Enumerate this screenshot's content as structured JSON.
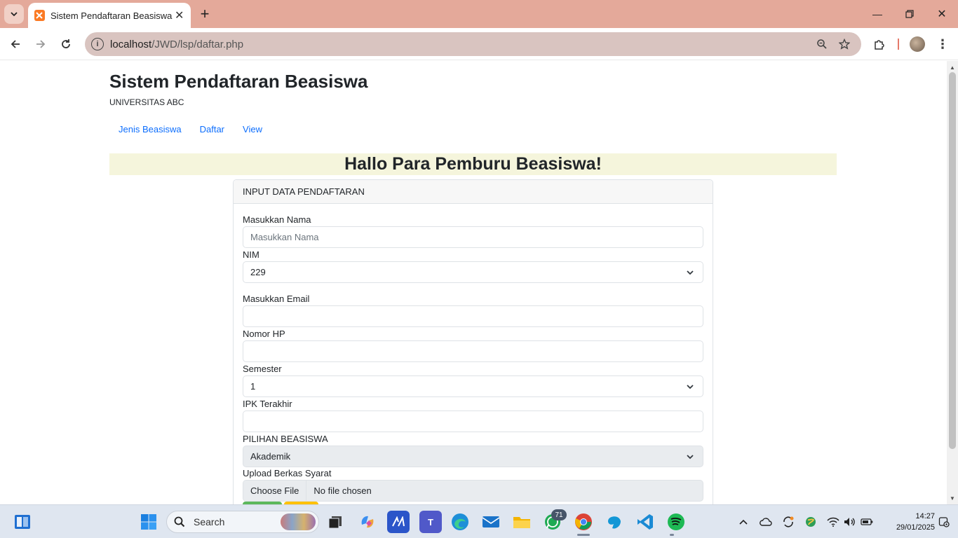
{
  "browser": {
    "tab_title": "Sistem Pendaftaran Beasiswa",
    "url_host": "localhost",
    "url_path": "/JWD/lsp/daftar.php"
  },
  "page": {
    "site_title": "Sistem Pendaftaran Beasiswa",
    "site_subtitle": "UNIVERSITAS ABC",
    "nav": [
      "Jenis Beasiswa",
      "Daftar",
      "View"
    ],
    "banner": "Hallo Para Pemburu Beasiswa!",
    "card_header": "INPUT DATA PENDAFTARAN",
    "form": {
      "nama_label": "Masukkan Nama",
      "nama_placeholder": "Masukkan Nama",
      "nim_label": "NIM",
      "nim_value": "229",
      "email_label": "Masukkan Email",
      "hp_label": "Nomor HP",
      "semester_label": "Semester",
      "semester_value": "1",
      "ipk_label": "IPK Terakhir",
      "beasiswa_label": "PILIHAN BEASISWA",
      "beasiswa_value": "Akademik",
      "upload_label": "Upload Berkas Syarat",
      "file_button": "Choose File",
      "file_status": "No file chosen"
    }
  },
  "taskbar": {
    "search_label": "Search",
    "whatsapp_badge": "71",
    "time": "14:27",
    "date": "29/01/2025"
  },
  "colors": {
    "titlebar": "#e4a99a",
    "omnibox": "#d9c4c0",
    "link": "#0d6efd",
    "banner_bg": "#f5f5dc",
    "btn_submit": "#5cb85c",
    "btn_reset": "#ffc107"
  }
}
